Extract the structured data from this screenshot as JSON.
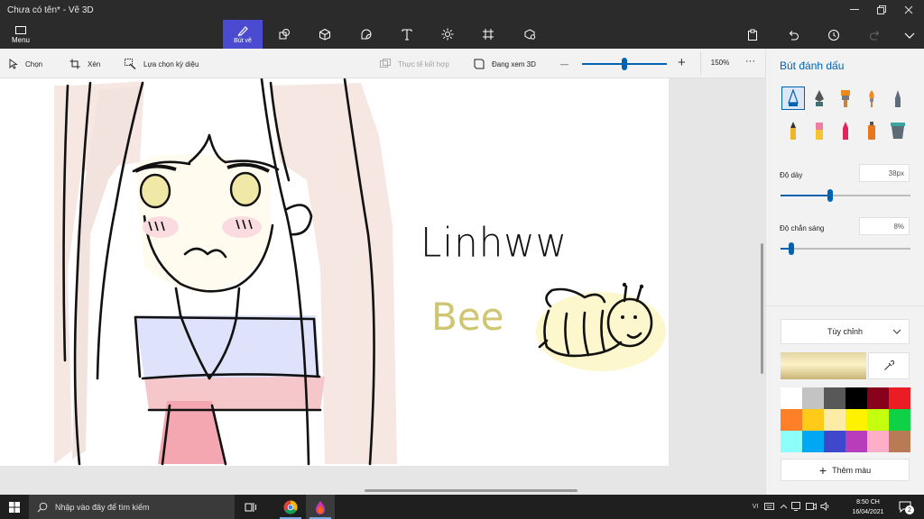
{
  "window": {
    "title": "Chưa có tên* - Vẽ 3D",
    "controls": [
      "minimize",
      "restore",
      "close"
    ]
  },
  "ribbon": {
    "menu_label": "Menu",
    "active_tab_label": "Bút vẽ",
    "tabs": [
      {
        "icon": "brush-icon",
        "label": "Bút vẽ",
        "active": true
      },
      {
        "icon": "2d-shapes-icon",
        "active": false
      },
      {
        "icon": "3d-shapes-icon",
        "active": false
      },
      {
        "icon": "stickers-icon",
        "active": false
      },
      {
        "icon": "text-icon",
        "glyph": "T",
        "active": false
      },
      {
        "icon": "effects-icon",
        "active": false
      },
      {
        "icon": "canvas-icon",
        "active": false
      },
      {
        "icon": "3d-library-icon",
        "active": false
      }
    ],
    "right_icons": [
      "paste-icon",
      "undo-icon",
      "history-icon",
      "redo-icon",
      "expand-icon"
    ]
  },
  "toolbar": {
    "select_label": "Chọn",
    "crop_label": "Xén",
    "magic_select_label": "Lựa chọn kỳ diệu",
    "mixed_reality_label": "Thực tế kết hợp",
    "view_3d_label": "Đang xem 3D",
    "zoom_minus": "—",
    "zoom_plus": "+",
    "zoom_value": "150%",
    "zoom_level_fraction": 0.5,
    "more_label": "···"
  },
  "canvas": {
    "signature_text": "Linhww",
    "bee_text": "Bee",
    "signature_color": "#111111",
    "bee_text_color": "#cfc673"
  },
  "panel": {
    "title": "Bút đánh dấu",
    "brushes": [
      "marker-icon",
      "calligraphy-pen-icon",
      "oil-brush-icon",
      "watercolor-icon",
      "pixel-pen-icon",
      "pencil-icon",
      "eraser-icon",
      "crayon-icon",
      "spray-can-icon",
      "fill-icon"
    ],
    "selected_brush": "marker-icon",
    "thickness": {
      "label": "Độ dày",
      "value": "38px",
      "fraction": 0.38
    },
    "opacity": {
      "label": "Độ chắn sáng",
      "value": "8%",
      "fraction": 0.08
    },
    "finish": {
      "value": "Tùy chỉnh"
    },
    "current_color": "#f3e9b8",
    "swatches": [
      "#ffffff",
      "#c3c3c3",
      "#585858",
      "#000000",
      "#88001b",
      "#ec1c24",
      "#ff7f27",
      "#ffca18",
      "#fdeca6",
      "#fff200",
      "#c4ff0e",
      "#0ed145",
      "#8cfffb",
      "#00a8f3",
      "#3f48cc",
      "#b83dba",
      "#ffaec8",
      "#b97a56"
    ],
    "add_color_label": "Thêm màu"
  },
  "taskbar": {
    "search_placeholder": "Nhập vào đây để tìm kiếm",
    "tray_lang": "VI",
    "time": "8:50 CH",
    "date": "16/04/2021",
    "notification_count": "2"
  }
}
